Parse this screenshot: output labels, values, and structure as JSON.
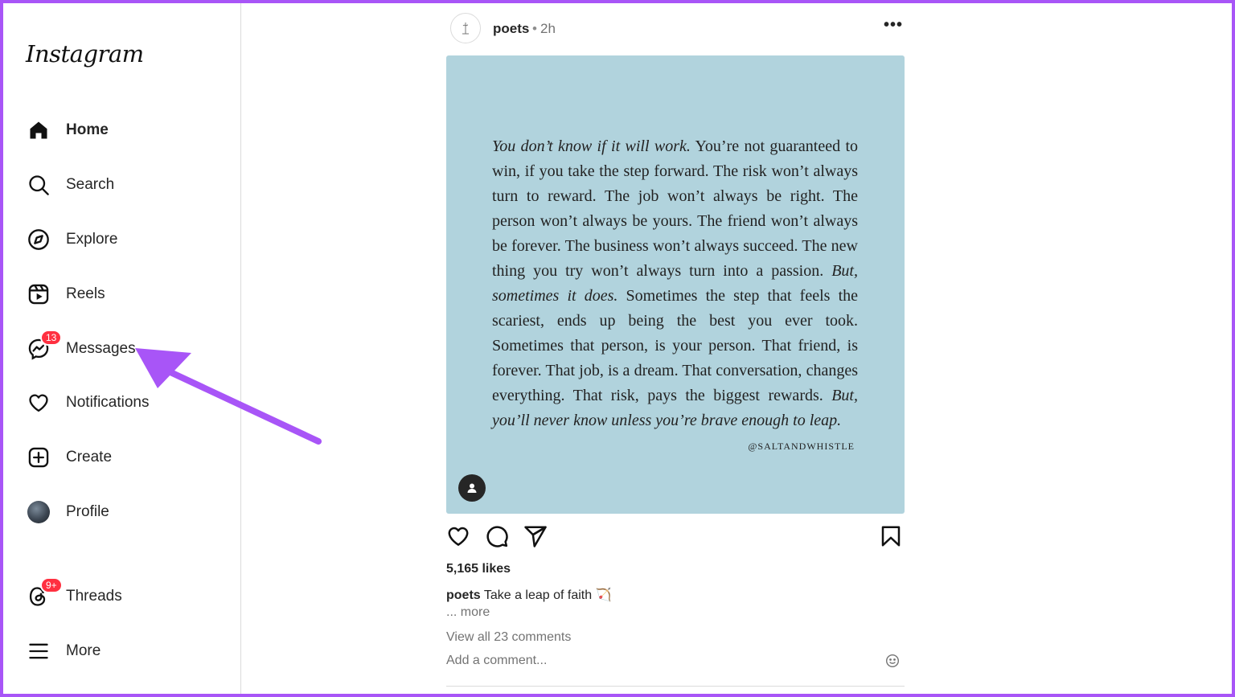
{
  "app": {
    "logo": "Instagram"
  },
  "sidebar": {
    "items": [
      {
        "label": "Home",
        "icon": "home-icon"
      },
      {
        "label": "Search",
        "icon": "search-icon"
      },
      {
        "label": "Explore",
        "icon": "compass-icon"
      },
      {
        "label": "Reels",
        "icon": "reels-icon"
      },
      {
        "label": "Messages",
        "icon": "messenger-icon",
        "badge": "13"
      },
      {
        "label": "Notifications",
        "icon": "heart-icon"
      },
      {
        "label": "Create",
        "icon": "plus-square-icon"
      },
      {
        "label": "Profile",
        "icon": "avatar"
      }
    ],
    "bottom": [
      {
        "label": "Threads",
        "icon": "threads-icon",
        "badge": "9+"
      },
      {
        "label": "More",
        "icon": "hamburger-icon"
      }
    ]
  },
  "post": {
    "username": "poets",
    "separator": "•",
    "time": "2h",
    "more": "•••",
    "quote": {
      "part1_italic": "You don’t know if it will work.",
      "part2": " You’re not guaranteed to win, if you take the step forward. The risk won’t always turn to reward. The job won’t always be right. The person won’t always be yours. The friend won’t always be forever. The business won’t always succeed. The new thing you try won’t always turn into a passion. ",
      "part3_italic": "But, sometimes it does.",
      "part4": " Sometimes the step that feels the scariest, ends up being the best you ever took. Sometimes that person, is your person. That friend, is forever. That job, is a dream. That conversation, changes everything. That risk, pays the biggest rewards. ",
      "part5_italic": "But, you’ll never know unless you’re brave enough to leap.",
      "source": "@SALTANDWHISTLE"
    },
    "likes": "5,165 likes",
    "caption_user": "poets",
    "caption_text": " Take a leap of faith 🏹",
    "more_link": "... more",
    "view_comments": "View all 23 comments",
    "comment_placeholder": "Add a comment..."
  },
  "colors": {
    "accent_arrow": "#a855f7",
    "badge": "#ff3040",
    "image_bg": "#b1d3dd"
  }
}
